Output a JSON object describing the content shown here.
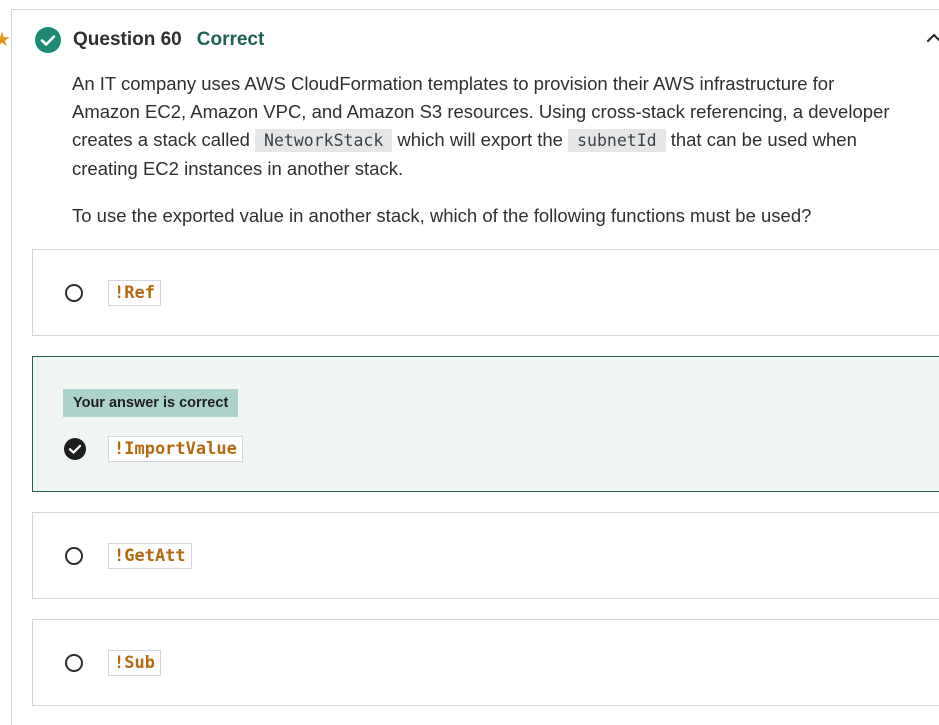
{
  "question": {
    "number_label": "Question 60",
    "status": "Correct",
    "body_line1": "An IT company uses AWS CloudFormation templates to provision their AWS infrastructure for",
    "body_line2": "Amazon EC2, Amazon VPC, and Amazon S3 resources. Using cross-stack referencing, a developer",
    "body_line3_a": "creates a stack called",
    "code_stack": "NetworkStack",
    "body_line3_b": "which will export the",
    "code_subnet": "subnetId",
    "body_line3_c": "that can be used when",
    "body_line4": "creating EC2 instances in another stack.",
    "prompt": "To use the exported value in another stack, which of the following functions must be used?"
  },
  "options": [
    {
      "code": "!Ref",
      "selected": false
    },
    {
      "code": "!ImportValue",
      "selected": true,
      "badge": "Your answer is correct"
    },
    {
      "code": "!GetAtt",
      "selected": false
    },
    {
      "code": "!Sub",
      "selected": false
    }
  ],
  "icons": {
    "status": "check-circle-icon",
    "collapse": "chevron-up-icon",
    "favorite": "star-icon"
  },
  "colors": {
    "correct_green": "#1e6055",
    "check_circle": "#1e8a73",
    "badge_bg": "#acd2cc",
    "code_orange": "#b4690e",
    "star": "#e59819"
  }
}
